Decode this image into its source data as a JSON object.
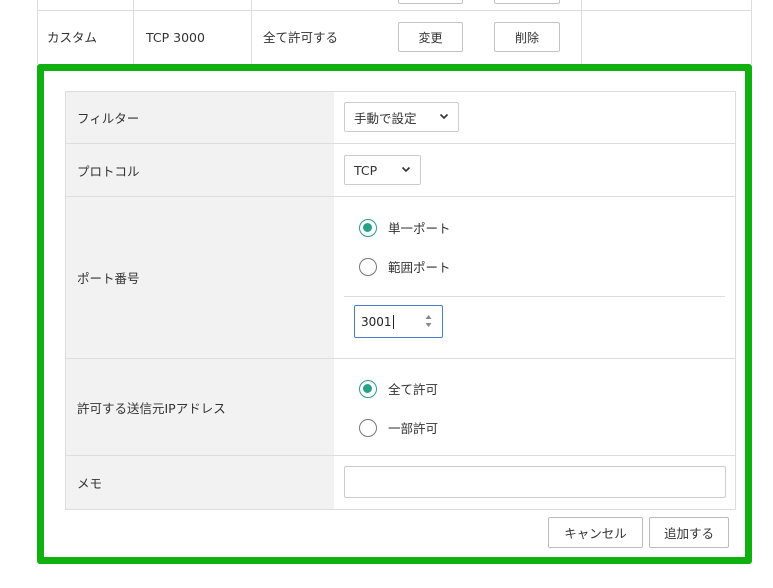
{
  "rule_table": {
    "row": {
      "name": "カスタム",
      "port": "TCP 3000",
      "permission": "全て許可する",
      "edit_label": "変更",
      "delete_label": "削除"
    }
  },
  "form": {
    "filter": {
      "label": "フィルター",
      "value": "手動で設定"
    },
    "protocol": {
      "label": "プロトコル",
      "value": "TCP"
    },
    "port": {
      "label": "ポート番号",
      "options": [
        "単一ポート",
        "範囲ポート"
      ],
      "selected": "単一ポート",
      "value": "3001"
    },
    "source_ip": {
      "label": "許可する送信元IPアドレス",
      "options": [
        "全て許可",
        "一部許可"
      ],
      "selected": "全て許可"
    },
    "memo": {
      "label": "メモ",
      "value": ""
    },
    "cancel_label": "キャンセル",
    "add_label": "追加する"
  },
  "colors": {
    "highlight_border": "#10b010",
    "radio_accent": "#2aa08a",
    "focus_border": "#4a7bd6"
  },
  "icons": [
    "chevron-down-icon",
    "spinner-icon"
  ]
}
